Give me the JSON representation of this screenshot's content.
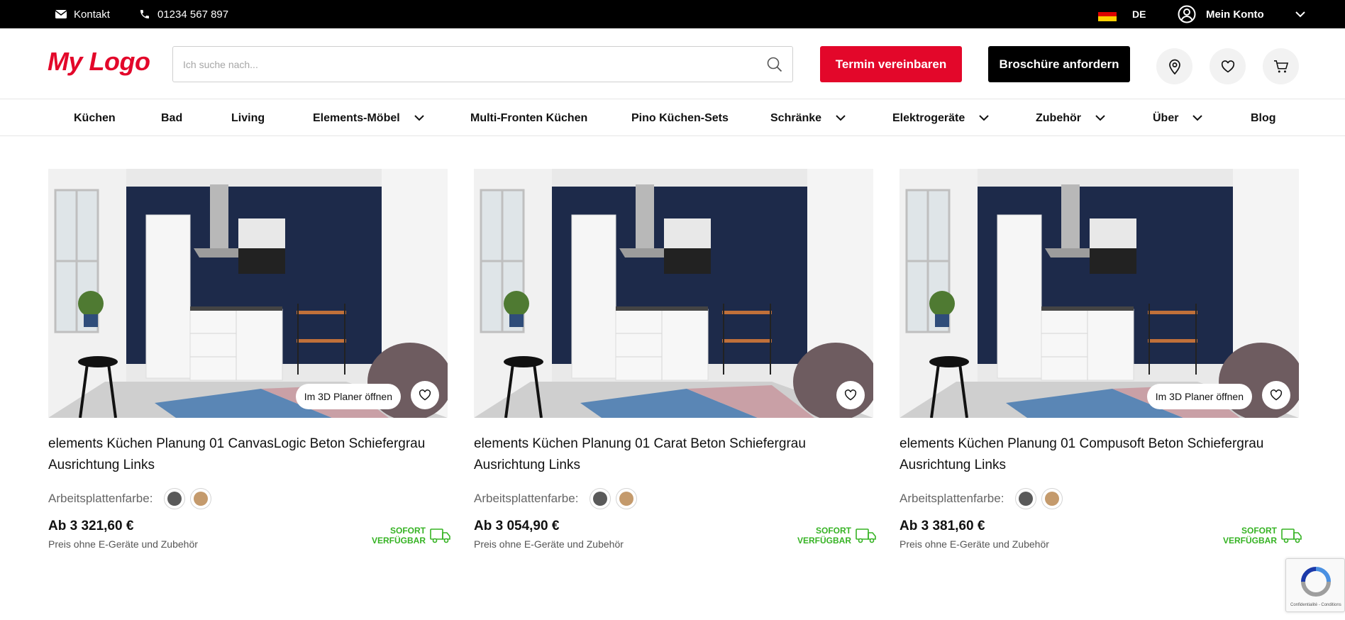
{
  "topbar": {
    "contact_label": "Kontakt",
    "phone": "01234 567 897",
    "language": "DE",
    "account_label": "Mein Konto",
    "icons": [
      "mail-icon",
      "phone-icon",
      "flag-de-icon",
      "user-circle-icon",
      "chevron-down-icon"
    ]
  },
  "header": {
    "logo": "My Logo",
    "search_placeholder": "Ich suche nach...",
    "appointment_button": "Termin vereinbaren",
    "brochure_button": "Broschüre anfordern",
    "icons": [
      "search-icon",
      "location-icon",
      "heart-icon",
      "cart-icon"
    ]
  },
  "nav": {
    "items": [
      {
        "label": "Küchen"
      },
      {
        "label": "Bad"
      },
      {
        "label": "Living"
      },
      {
        "label": "Elements-Möbel"
      },
      {
        "label": "Multi-Fronten Küchen"
      },
      {
        "label": "Pino Küchen-Sets"
      },
      {
        "label": "Schränke"
      },
      {
        "label": "Elektrogeräte"
      },
      {
        "label": "Zubehör"
      },
      {
        "label": "Über"
      },
      {
        "label": "Blog"
      }
    ]
  },
  "products": [
    {
      "title": "elements Küchen Planung 01 CanvasLogic Beton Schiefergrau Ausrichtung Links",
      "planer_label": "Im 3D Planer öffnen",
      "swatch_label": "Arbeitsplattenfarbe:",
      "price": "Ab 3 321,60 €",
      "price_note": "Preis ohne E-Geräte und Zubehör",
      "availability_line1": "SOFORT",
      "availability_line2": "VERFÜGBAR"
    },
    {
      "title": "elements Küchen Planung 01 Carat Beton Schiefergrau Ausrichtung Links",
      "swatch_label": "Arbeitsplattenfarbe:",
      "price": "Ab 3 054,90 €",
      "price_note": "Preis ohne E-Geräte und Zubehör",
      "availability_line1": "SOFORT",
      "availability_line2": "VERFÜGBAR"
    },
    {
      "title": "elements Küchen Planung 01 Compusoft Beton Schiefergrau Ausrichtung Links",
      "planer_label": "Im 3D Planer öffnen",
      "swatch_label": "Arbeitsplattenfarbe:",
      "price": "Ab 3 381,60 €",
      "price_note": "Preis ohne E-Geräte und Zubehör",
      "availability_line1": "SOFORT",
      "availability_line2": "VERFÜGBAR"
    }
  ],
  "colors": {
    "brand_red": "#e3072a",
    "topbar_bg": "#000000",
    "available_green": "#36b324",
    "swatch_dark": "#5a5a5a",
    "swatch_wood": "#c49a6c"
  },
  "recaptcha": {
    "text": "Confidentialité - Conditions"
  }
}
